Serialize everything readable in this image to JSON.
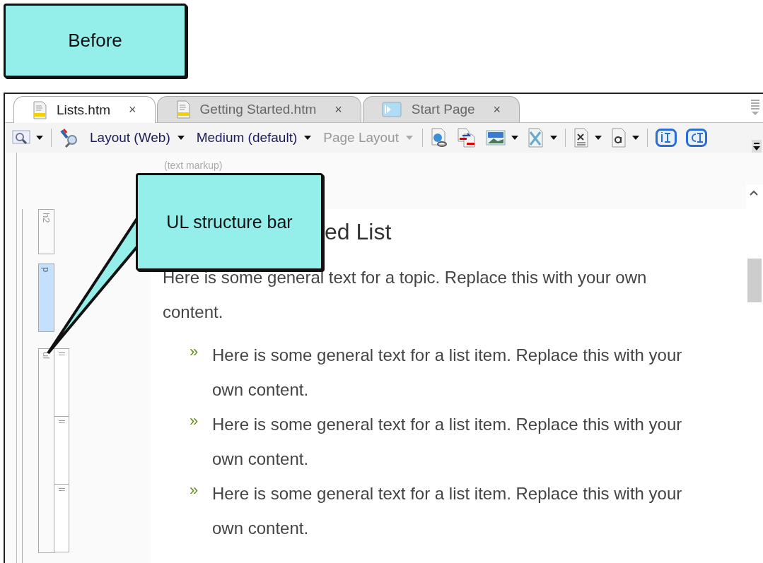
{
  "callouts": [
    {
      "kind": "label",
      "text": "Before"
    },
    {
      "kind": "pointer",
      "text": "UL structure bar"
    }
  ],
  "tabs": [
    {
      "label": "Lists.htm",
      "close": "×",
      "selected": true
    },
    {
      "label": "Getting Started.htm",
      "close": "×",
      "selected": false
    },
    {
      "label": "Start Page",
      "close": "×",
      "selected": false
    }
  ],
  "toolbar": [
    {
      "kind": "preview",
      "menu": true
    },
    {
      "kind": "separator"
    },
    {
      "kind": "styles",
      "menu": false
    },
    {
      "kind": "dropdown",
      "label": "Layout (Web)",
      "disabled": false
    },
    {
      "kind": "dropdown",
      "label": "Medium (default)",
      "disabled": false
    },
    {
      "kind": "dropdown",
      "label": "Page Layout",
      "disabled": true
    },
    {
      "kind": "separator"
    },
    {
      "kind": "link",
      "menu": false
    },
    {
      "kind": "crossref",
      "menu": false
    },
    {
      "kind": "image",
      "menu": true
    },
    {
      "kind": "multimedia",
      "menu": true
    },
    {
      "kind": "separator"
    },
    {
      "kind": "variable",
      "menu": true
    },
    {
      "kind": "snippet",
      "menu": true
    },
    {
      "kind": "separator"
    },
    {
      "kind": "index",
      "menu": false
    },
    {
      "kind": "concept",
      "menu": false
    }
  ],
  "markup_hint": "(text markup)",
  "structure_bar": [
    {
      "tag": "h2",
      "selected": false
    },
    {
      "tag": "p",
      "selected": true
    },
    {
      "tag": "ul",
      "selected": false,
      "children": [
        {
          "tag": "li",
          "selected": false
        },
        {
          "tag": "li",
          "selected": false
        },
        {
          "tag": "li",
          "selected": false
        }
      ]
    }
  ],
  "document": {
    "heading": "ed List",
    "paragraph": "Here is some general text for a topic. Replace this with your own content.",
    "list_items": [
      {
        "bullet": "»",
        "text": "Here is some general text for a list item. Replace this with your own content."
      },
      {
        "bullet": "»",
        "text": "Here is some general text for a list item. Replace this with your own content."
      },
      {
        "bullet": "»",
        "text": "Here is some general text for a list item. Replace this with your own content."
      }
    ]
  }
}
